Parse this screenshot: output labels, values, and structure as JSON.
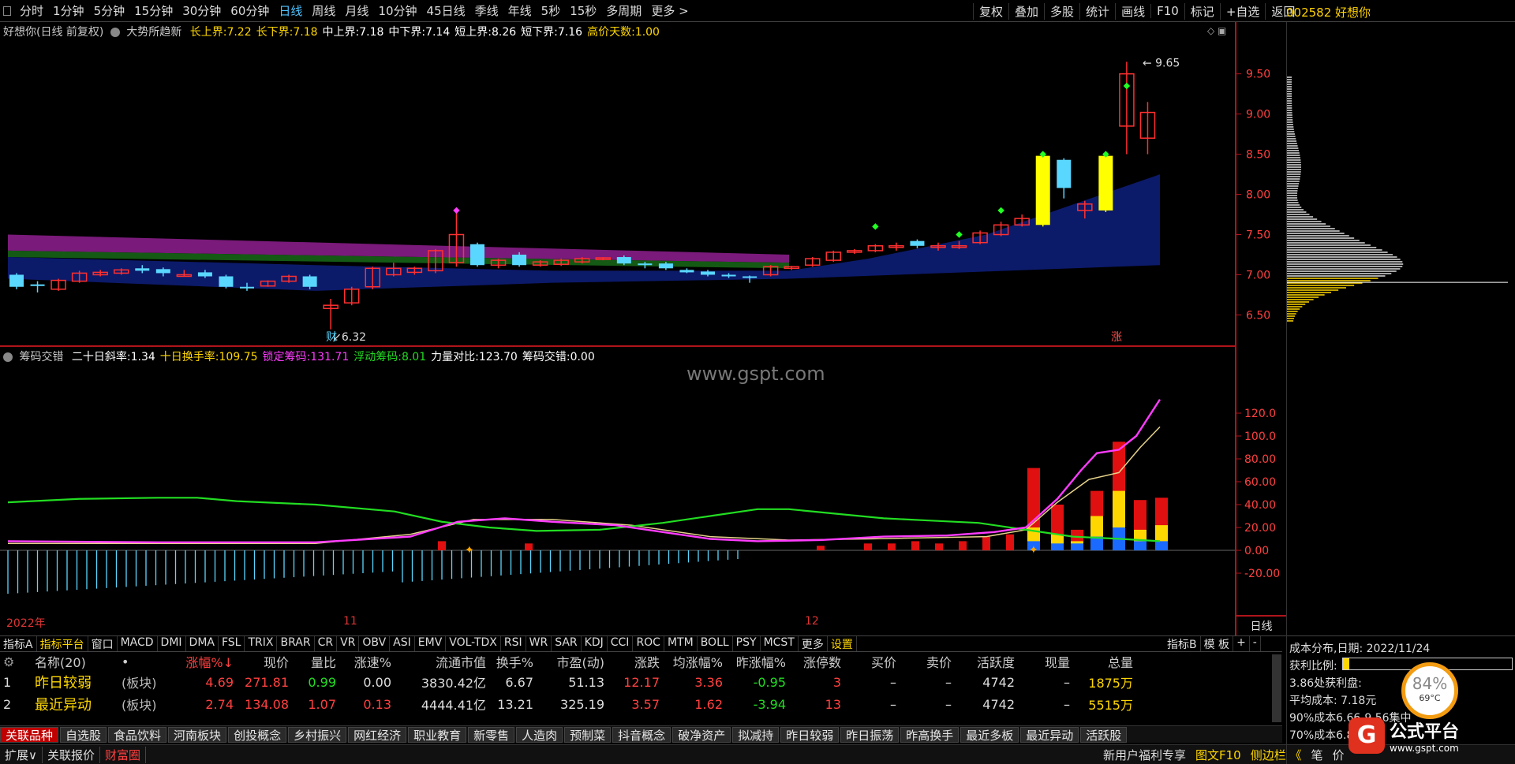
{
  "periods": [
    "分时",
    "1分钟",
    "5分钟",
    "15分钟",
    "30分钟",
    "60分钟",
    "日线",
    "周线",
    "月线",
    "10分钟",
    "45日线",
    "季线",
    "年线",
    "5秒",
    "15秒",
    "多周期",
    "更多 >"
  ],
  "active_period": "日线",
  "toolbar_right": [
    "复权",
    "叠加",
    "多股",
    "统计",
    "画线",
    "F10",
    "标记",
    "+自选",
    "返回"
  ],
  "stock_title": "002582 好想你",
  "main": {
    "name": "好想你(日线 前复权)",
    "indicator": "大势所趋新",
    "params": [
      {
        "label": "长上界:",
        "value": "7.22",
        "color": "#ffd700"
      },
      {
        "label": "长下界:",
        "value": "7.18",
        "color": "#ffd700"
      },
      {
        "label": "中上界:",
        "value": "7.18",
        "color": "#ffffff"
      },
      {
        "label": "中下界:",
        "value": "7.14",
        "color": "#ffffff"
      },
      {
        "label": "短上界:",
        "value": "8.26",
        "color": "#ffffff"
      },
      {
        "label": "短下界:",
        "value": "7.16",
        "color": "#ffffff"
      },
      {
        "label": "高价天数:",
        "value": "1.00",
        "color": "#ffd700"
      }
    ],
    "y_ticks": [
      "9.50",
      "9.00",
      "8.50",
      "8.00",
      "7.50",
      "7.00",
      "6.50"
    ],
    "high_label": "9.65",
    "low_label": "6.32",
    "cai_label": "财",
    "zhang_label": "涨"
  },
  "indicator": {
    "name": "筹码交错",
    "params": [
      {
        "label": "二十日斜率:",
        "value": "1.34",
        "color": "#ffffff"
      },
      {
        "label": "十日换手率:",
        "value": "109.75",
        "color": "#ffd700"
      },
      {
        "label": "锁定筹码:",
        "value": "131.71",
        "color": "#ff3cff"
      },
      {
        "label": "浮动筹码:",
        "value": "8.01",
        "color": "#22dd22"
      },
      {
        "label": "力量对比:",
        "value": "123.70",
        "color": "#ffffff"
      },
      {
        "label": "筹码交错:",
        "value": "0.00",
        "color": "#ffffff"
      }
    ],
    "y_ticks": [
      "120.0",
      "100.0",
      "80.00",
      "60.00",
      "40.00",
      "20.00",
      "0.00",
      "-20.00"
    ],
    "watermark": "www.gspt.com"
  },
  "date_labels": [
    "2022年",
    "11",
    "12"
  ],
  "axis_corner": "日线",
  "indicator_tabs": [
    "指标A",
    "指标平台",
    "窗口",
    "MACD",
    "DMI",
    "DMA",
    "FSL",
    "TRIX",
    "BRAR",
    "CR",
    "VR",
    "OBV",
    "ASI",
    "EMV",
    "VOL-TDX",
    "RSI",
    "WR",
    "SAR",
    "KDJ",
    "CCI",
    "ROC",
    "MTM",
    "BOLL",
    "PSY",
    "MCST",
    "更多",
    "设置"
  ],
  "indicator_tabs_right": [
    "指标B",
    "模 板",
    "+",
    "-"
  ],
  "table": {
    "headers": [
      "",
      "名称(20)",
      "•",
      "涨幅%↓",
      "现价",
      "量比",
      "涨速%",
      "流通市值",
      "换手%",
      "市盈(动)",
      "涨跌",
      "均涨幅%",
      "昨涨幅%",
      "涨停数",
      "买价",
      "卖价",
      "活跃度",
      "现量",
      "总量"
    ],
    "rows": [
      [
        "1",
        "昨日较弱",
        "(板块)",
        "4.69",
        "271.81",
        "0.99",
        "0.00",
        "3830.42亿",
        "6.67",
        "51.13",
        "12.17",
        "3.36",
        "-0.95",
        "3",
        "–",
        "–",
        "4742",
        "–",
        "1875万"
      ],
      [
        "2",
        "最近异动",
        "(板块)",
        "2.74",
        "134.08",
        "1.07",
        "0.13",
        "4444.41亿",
        "13.21",
        "325.19",
        "3.57",
        "1.62",
        "-3.94",
        "13",
        "–",
        "–",
        "4742",
        "–",
        "5515万"
      ]
    ]
  },
  "bottom_tabs": [
    "关联品种",
    "自选股",
    "食品饮料",
    "河南板块",
    "创投概念",
    "乡村振兴",
    "网红经济",
    "职业教育",
    "新零售",
    "人造肉",
    "预制菜",
    "抖音概念",
    "破净资产",
    "拟减持",
    "昨日较弱",
    "昨日振荡",
    "昨高换手",
    "最近多板",
    "最近异动",
    "活跃股"
  ],
  "status_bar": [
    "扩展∨",
    "关联报价",
    "财富圈"
  ],
  "status_right": [
    "新用户福利专享",
    "图文F10",
    "侧边栏 《",
    "笔",
    "价"
  ],
  "side": {
    "title": "成本分布,日期: 2022/11/24",
    "profit_label": "获利比例:",
    "rows": [
      "3.86处获利盘:",
      "平均成本: 7.18元",
      "90%成本6.66-9.56集中",
      "70%成本6.8"
    ]
  },
  "badge": {
    "percent": "84%",
    "temp": "69°C"
  },
  "logo": {
    "brand": "公式平台",
    "url": "www.gspt.com"
  }
}
